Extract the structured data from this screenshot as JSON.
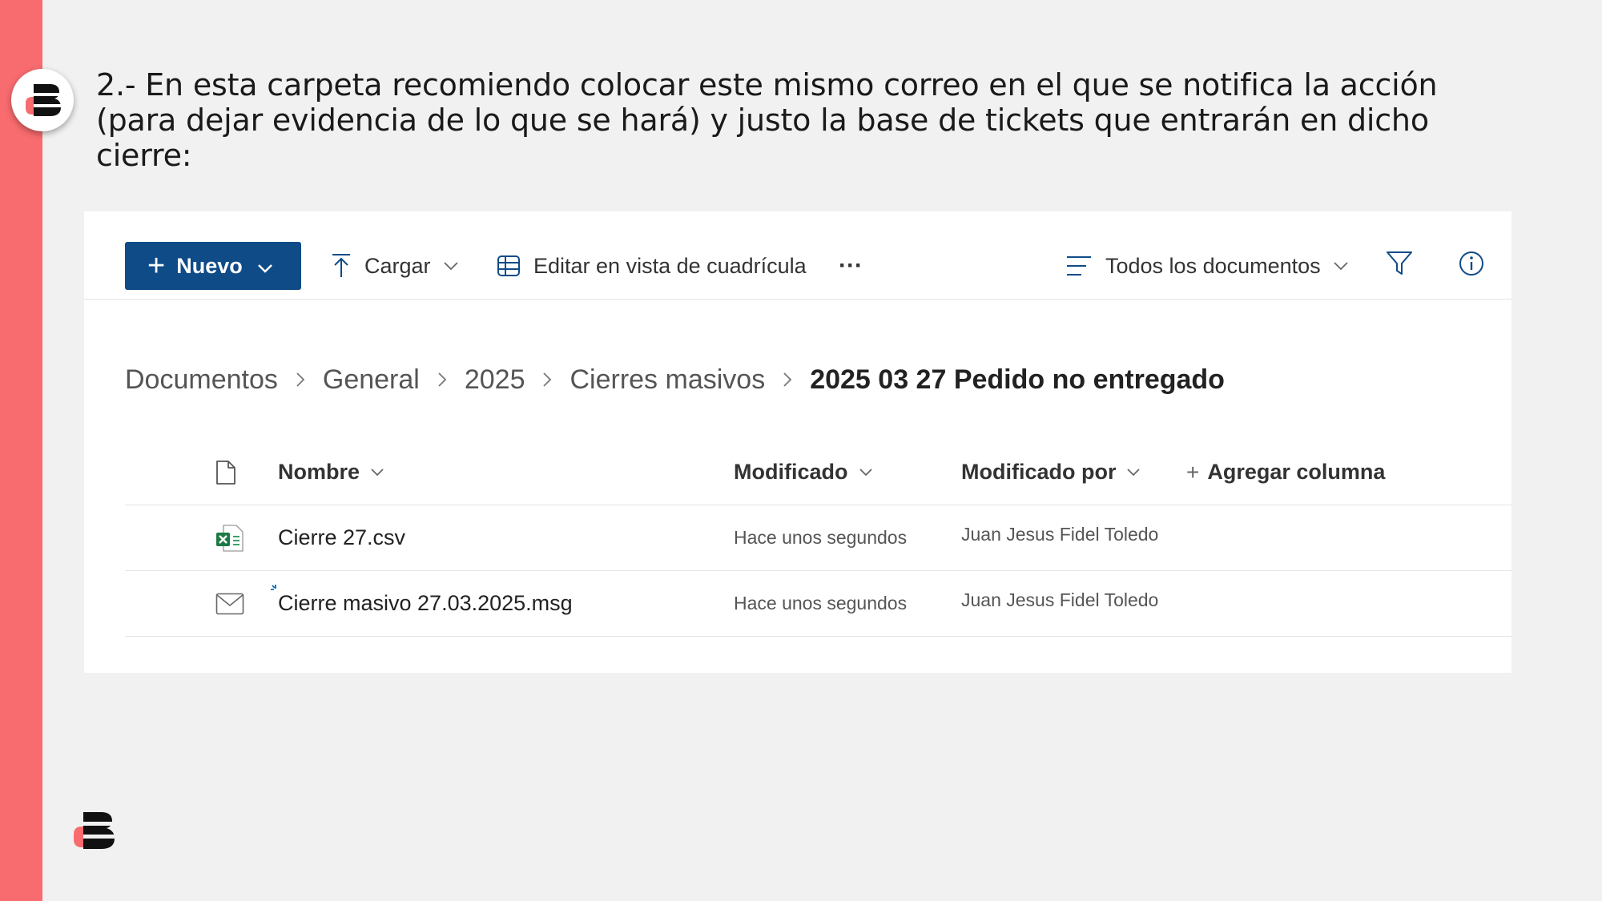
{
  "slide": {
    "instruction": "2.- En esta carpeta recomiendo colocar este mismo correo en el que se notifica la acción (para dejar evidencia de lo que se hará) y justo la base de tickets que entrarán en dicho cierre:",
    "accent_color": "#f86b6e"
  },
  "toolbar": {
    "new_label": "Nuevo",
    "upload_label": "Cargar",
    "grid_edit_label": "Editar en vista de cuadrícula",
    "more_label": "···",
    "view_label": "Todos los documentos",
    "primary_color": "#0f4b87"
  },
  "breadcrumb": {
    "items": [
      "Documentos",
      "General",
      "2025",
      "Cierres masivos"
    ],
    "current": "2025 03 27 Pedido no entregado"
  },
  "table": {
    "columns": {
      "name": "Nombre",
      "modified": "Modificado",
      "modified_by": "Modificado por",
      "add_column": "Agregar columna"
    },
    "rows": [
      {
        "icon": "excel-file-icon",
        "name": "Cierre 27.csv",
        "modified": "Hace unos segundos",
        "modified_by": "Juan Jesus Fidel Toledo"
      },
      {
        "icon": "email-file-icon",
        "name": "Cierre masivo 27.03.2025.msg",
        "modified": "Hace unos segundos",
        "modified_by": "Juan Jesus Fidel Toledo"
      }
    ]
  }
}
